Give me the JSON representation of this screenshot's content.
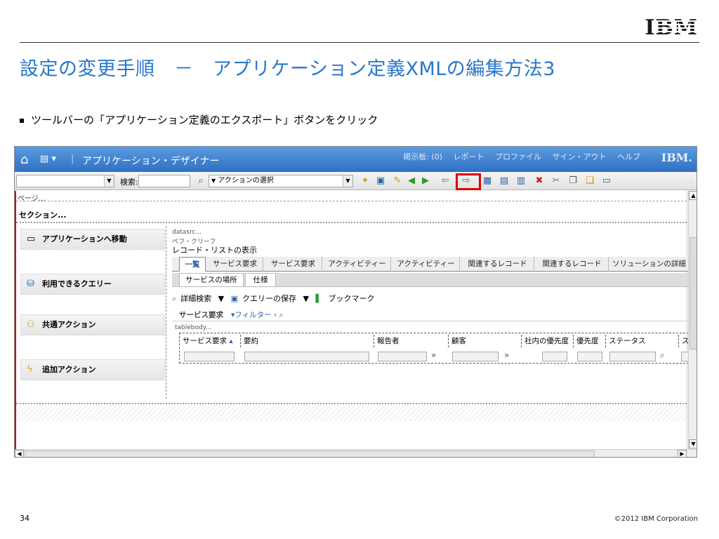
{
  "slide": {
    "logo": "IBM",
    "title": "設定の変更手順　－　アプリケーション定義XMLの編集方法3",
    "bullet": "ツールバーの「アプリケーション定義のエクスポート」ボタンをクリック",
    "page_number": "34",
    "copyright": "©2012 IBM Corporation"
  },
  "app": {
    "title": "アプリケーション・デザイナー",
    "pages_icon": "▾",
    "top_links": [
      "掲示板: (0)",
      "レポート",
      "プロファイル",
      "サイン・アウト",
      "ヘルプ"
    ],
    "ibm_small": "IBM."
  },
  "toolbar": {
    "search_label": "検索:",
    "search_value": "",
    "action_select": "アクションの選択",
    "highlight_color": "#e00000"
  },
  "canvas": {
    "page_label": "ページ...",
    "section_label": "セクション...",
    "left_items": [
      {
        "label": "アプリケーションへ移動",
        "icon": "window-icon"
      },
      {
        "label": "利用できるクエリー",
        "icon": "database-icon"
      },
      {
        "label": "共通アクション",
        "icon": "people-icon"
      },
      {
        "label": "追加アクション",
        "icon": "lightning-icon"
      }
    ],
    "datasrc": "datasrc...",
    "webclient": "ペフ・クリーフ",
    "record_list_title": "レコード・リストの表示",
    "tabs": [
      "一覧",
      "サービス要求",
      "サービス要求",
      "アクティビティー",
      "アクティビティー",
      "関連するレコード",
      "関連するレコード",
      "ソリューションの詳細"
    ],
    "sub_tabs": [
      "サービスの場所",
      "仕様"
    ],
    "actions": {
      "advanced_search": "詳細検索",
      "save_query": "クエリーの保存",
      "bookmark": "ブックマーク"
    },
    "table_title": "サービス要求",
    "filter": "フィルター",
    "tablebody": "tablebody...",
    "columns": [
      "サービス要求",
      "要約",
      "報告者",
      "顧客",
      "社内の優先度",
      "優先度",
      "ステータス",
      "ス"
    ]
  }
}
